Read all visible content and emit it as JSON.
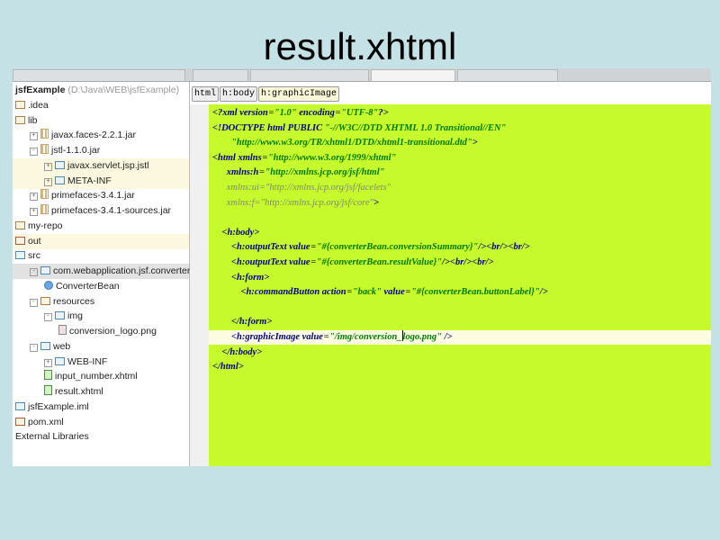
{
  "slide_title": "result.xhtml",
  "tree": [
    {
      "label": "jsfExample",
      "suffix": " (D:\\Java\\WEB\\jsfExample)",
      "indent": 0,
      "icon": "none",
      "bold": true
    },
    {
      "label": ".idea",
      "indent": 0,
      "icon": "folder"
    },
    {
      "label": "lib",
      "indent": 0,
      "icon": "folder"
    },
    {
      "label": "javax.faces-2.2.1.jar",
      "indent": 1,
      "icon": "jar",
      "exp": "+"
    },
    {
      "label": "jstl-1.1.0.jar",
      "indent": 1,
      "icon": "jar",
      "exp": "-"
    },
    {
      "label": "javax.servlet.jsp.jstl",
      "indent": 2,
      "icon": "package",
      "exp": "+",
      "hl": true
    },
    {
      "label": "META-INF",
      "indent": 2,
      "icon": "package",
      "exp": "+",
      "hl": true
    },
    {
      "label": "primefaces-3.4.1.jar",
      "indent": 1,
      "icon": "jar",
      "exp": "+"
    },
    {
      "label": "primefaces-3.4.1-sources.jar",
      "indent": 1,
      "icon": "jar",
      "exp": "+"
    },
    {
      "label": "my-repo",
      "indent": 0,
      "icon": "folder"
    },
    {
      "label": "out",
      "indent": 0,
      "icon": "out",
      "hl": true
    },
    {
      "label": "src",
      "indent": 0,
      "icon": "src"
    },
    {
      "label": "com.webapplication.jsf.converter",
      "indent": 1,
      "icon": "package",
      "exp": "-",
      "sel": true
    },
    {
      "label": "ConverterBean",
      "indent": 2,
      "icon": "class"
    },
    {
      "label": "resources",
      "indent": 1,
      "icon": "folder",
      "exp": "-"
    },
    {
      "label": "img",
      "indent": 2,
      "icon": "package",
      "exp": "-"
    },
    {
      "label": "conversion_logo.png",
      "indent": 3,
      "icon": "png"
    },
    {
      "label": "web",
      "indent": 1,
      "icon": "package",
      "exp": "-"
    },
    {
      "label": "WEB-INF",
      "indent": 2,
      "icon": "package",
      "exp": "+"
    },
    {
      "label": "input_number.xhtml",
      "indent": 2,
      "icon": "xhtml"
    },
    {
      "label": "result.xhtml",
      "indent": 2,
      "icon": "xhtml"
    },
    {
      "label": "jsfExample.iml",
      "indent": 0,
      "icon": "iml"
    },
    {
      "label": "pom.xml",
      "indent": 0,
      "icon": "maven"
    },
    {
      "label": "External Libraries",
      "indent": 0,
      "icon": "none"
    }
  ],
  "breadcrumbs": [
    "html",
    "h:body",
    "h:graphicImage"
  ],
  "code_lines": [
    [
      [
        "tag",
        "<?xml "
      ],
      [
        "tag",
        "version"
      ],
      [
        "txt",
        "="
      ],
      [
        "val",
        "\"1.0\""
      ],
      [
        "tag",
        " encoding"
      ],
      [
        "txt",
        "="
      ],
      [
        "val",
        "\"UTF-8\""
      ],
      [
        "tag",
        "?>"
      ]
    ],
    [
      [
        "tag",
        "<!DOCTYPE html PUBLIC "
      ],
      [
        "val",
        "\"-//W3C//DTD XHTML 1.0 Transitional//EN\""
      ]
    ],
    [
      [
        "val",
        "        \"http://www.w3.org/TR/xhtml1/DTD/xhtml1-transitional.dtd\""
      ],
      [
        "tag",
        ">"
      ]
    ],
    [
      [
        "tag",
        "<html xmlns"
      ],
      [
        "txt",
        "="
      ],
      [
        "val",
        "\"http://www.w3.org/1999/xhtml\""
      ]
    ],
    [
      [
        "tag",
        "      xmlns:h"
      ],
      [
        "txt",
        "="
      ],
      [
        "val",
        "\"http://xmlns.jcp.org/jsf/html\""
      ]
    ],
    [
      [
        "dim",
        "      xmlns:ui=\"http://xmlns.jcp.org/jsf/facelets\""
      ]
    ],
    [
      [
        "dim",
        "      xmlns:f=\"http://xmlns.jcp.org/jsf/core\""
      ],
      [
        "tag",
        ">"
      ]
    ],
    [],
    [
      [
        "tag",
        "    <h:body>"
      ]
    ],
    [
      [
        "tag",
        "        <h:outputText value"
      ],
      [
        "txt",
        "="
      ],
      [
        "val",
        "\"#{converterBean.conversionSummary}\""
      ],
      [
        "tag",
        "/><br/><br/>"
      ]
    ],
    [
      [
        "tag",
        "        <h:outputText value"
      ],
      [
        "txt",
        "="
      ],
      [
        "val",
        "\"#{converterBean.resultValue}\""
      ],
      [
        "tag",
        "/><br/><br/>"
      ]
    ],
    [
      [
        "tag",
        "        <h:form>"
      ]
    ],
    [
      [
        "tag",
        "            <h:commandButton action"
      ],
      [
        "txt",
        "="
      ],
      [
        "val",
        "\"back\""
      ],
      [
        "tag",
        " value"
      ],
      [
        "txt",
        "="
      ],
      [
        "val",
        "\"#{converterBean.buttonLabel}\""
      ],
      [
        "tag",
        "/>"
      ]
    ],
    [],
    [
      [
        "tag",
        "        </h:form>"
      ]
    ],
    [
      [
        "tag",
        "        <h:graphicImage value"
      ],
      [
        "txt",
        "="
      ],
      [
        "val",
        "\"/img/conversion_"
      ],
      [
        "caret",
        ""
      ],
      [
        "val",
        "logo.png\""
      ],
      [
        "tag",
        " />"
      ]
    ],
    [
      [
        "tag",
        "    </h:body>"
      ]
    ],
    [
      [
        "tag",
        "</html>"
      ]
    ]
  ],
  "current_line": 15
}
